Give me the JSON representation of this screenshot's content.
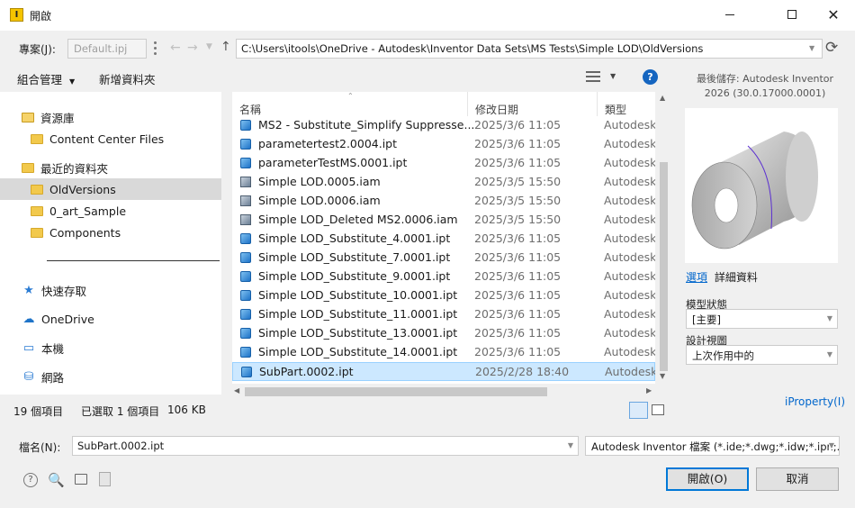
{
  "window": {
    "title": "開啟",
    "app_icon_glyph": "I"
  },
  "toolbar1": {
    "project_label": "專案(J):",
    "project_value": "Default.ipj",
    "path": "C:\\Users\\itools\\OneDrive - Autodesk\\Inventor Data Sets\\MS Tests\\Simple LOD\\OldVersions"
  },
  "toolbar2": {
    "organize": "組合管理",
    "new_folder": "新增資料夾"
  },
  "preview": {
    "saved_label": "最後儲存: Autodesk Inventor",
    "version": "2026 (30.0.17000.0001)",
    "tab_options": "選項",
    "tab_details": "詳細資料",
    "model_state_label": "模型狀態",
    "model_state_value": "[主要]",
    "design_view_label": "設計視圖",
    "design_view_value": "上次作用中的",
    "iproperty": "iProperty(I)"
  },
  "nav": {
    "items": [
      {
        "label": "資源庫",
        "icon": "library-icon",
        "indent": 0
      },
      {
        "label": "Content Center Files",
        "icon": "folder-icon",
        "indent": 1
      },
      {
        "label": "最近的資料夾",
        "icon": "recent-folder-icon",
        "indent": 0
      },
      {
        "label": "OldVersions",
        "icon": "folder-icon",
        "indent": 1,
        "selected": true
      },
      {
        "label": "0_art_Sample",
        "icon": "folder-icon",
        "indent": 1
      },
      {
        "label": "Components",
        "icon": "folder-icon",
        "indent": 1
      },
      {
        "label": "快速存取",
        "icon": "star-icon",
        "indent": 0
      },
      {
        "label": "OneDrive",
        "icon": "cloud-icon",
        "indent": 0
      },
      {
        "label": "本機",
        "icon": "computer-icon",
        "indent": 0
      },
      {
        "label": "網路",
        "icon": "network-icon",
        "indent": 0
      }
    ]
  },
  "files": {
    "columns": {
      "name": "名稱",
      "date": "修改日期",
      "type": "類型"
    },
    "rows": [
      {
        "name": "MS2 - Substitute_Simplify Suppresse...",
        "date": "2025/3/6 11:05",
        "type": "Autodesk",
        "kind": "ipt"
      },
      {
        "name": "parametertest2.0004.ipt",
        "date": "2025/3/6 11:05",
        "type": "Autodesk",
        "kind": "ipt"
      },
      {
        "name": "parameterTestMS.0001.ipt",
        "date": "2025/3/6 11:05",
        "type": "Autodesk",
        "kind": "ipt"
      },
      {
        "name": "Simple LOD.0005.iam",
        "date": "2025/3/5 15:50",
        "type": "Autodesk",
        "kind": "iam"
      },
      {
        "name": "Simple LOD.0006.iam",
        "date": "2025/3/5 15:50",
        "type": "Autodesk",
        "kind": "iam"
      },
      {
        "name": "Simple LOD_Deleted MS2.0006.iam",
        "date": "2025/3/5 15:50",
        "type": "Autodesk",
        "kind": "iam"
      },
      {
        "name": "Simple LOD_Substitute_4.0001.ipt",
        "date": "2025/3/6 11:05",
        "type": "Autodesk",
        "kind": "ipt"
      },
      {
        "name": "Simple LOD_Substitute_7.0001.ipt",
        "date": "2025/3/6 11:05",
        "type": "Autodesk",
        "kind": "ipt"
      },
      {
        "name": "Simple LOD_Substitute_9.0001.ipt",
        "date": "2025/3/6 11:05",
        "type": "Autodesk",
        "kind": "ipt"
      },
      {
        "name": "Simple LOD_Substitute_10.0001.ipt",
        "date": "2025/3/6 11:05",
        "type": "Autodesk",
        "kind": "ipt"
      },
      {
        "name": "Simple LOD_Substitute_11.0001.ipt",
        "date": "2025/3/6 11:05",
        "type": "Autodesk",
        "kind": "ipt"
      },
      {
        "name": "Simple LOD_Substitute_13.0001.ipt",
        "date": "2025/3/6 11:05",
        "type": "Autodesk",
        "kind": "ipt"
      },
      {
        "name": "Simple LOD_Substitute_14.0001.ipt",
        "date": "2025/3/6 11:05",
        "type": "Autodesk",
        "kind": "ipt"
      },
      {
        "name": "SubPart.0002.ipt",
        "date": "2025/2/28 18:40",
        "type": "Autodesk",
        "kind": "ipt",
        "selected": true
      }
    ]
  },
  "status": {
    "count": "19 個項目",
    "selected": "已選取 1 個項目",
    "size": "106 KB"
  },
  "bottom": {
    "filename_label": "檔名(N):",
    "filename_value": "SubPart.0002.ipt",
    "filter": "Autodesk Inventor 檔案 (*.ide;*.dwg;*.idw;*.ipn;...",
    "open": "開啟(O)",
    "cancel": "取消"
  },
  "colors": {
    "accent": "#0078d7",
    "selection": "#cce8ff"
  }
}
